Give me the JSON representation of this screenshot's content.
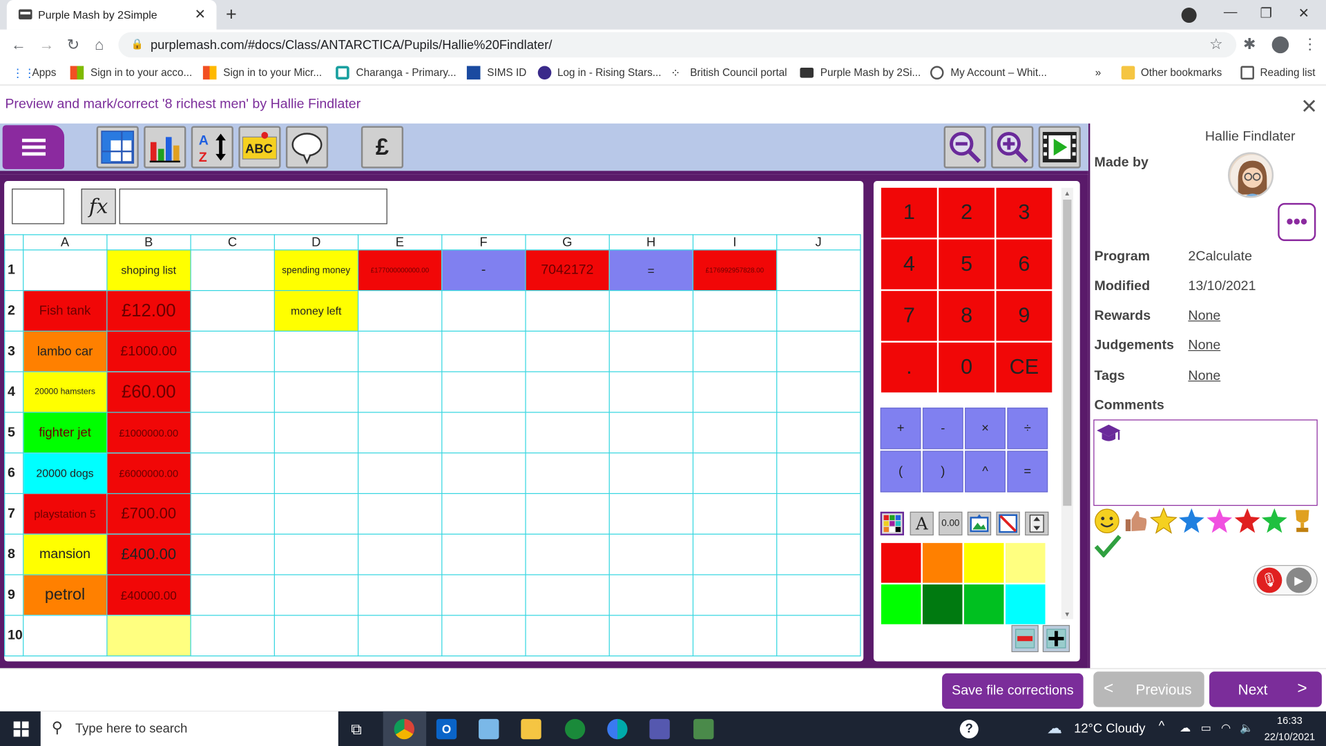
{
  "browser": {
    "tab_title": "Purple Mash by 2Simple",
    "url": "purplemash.com/#docs/Class/ANTARCTICA/Pupils/Hallie%20Findlater/",
    "bookmarks": [
      "Apps",
      "Sign in to your acco...",
      "Sign in to your Micr...",
      "Charanga - Primary...",
      "SIMS ID",
      "Log in - Rising Stars...",
      "British Council portal",
      "Purple Mash by 2Si...",
      "My Account – Whit..."
    ],
    "more_bookmarks": "»",
    "other_bookmarks": "Other bookmarks",
    "reading_list": "Reading list"
  },
  "header": {
    "title": "Preview and mark/correct '8 richest men' by Hallie Findlater"
  },
  "toolbar": {
    "currency_label": "£"
  },
  "sheet": {
    "columns": [
      "A",
      "B",
      "C",
      "D",
      "E",
      "F",
      "G",
      "H",
      "I",
      "J"
    ],
    "rows": [
      {
        "n": "1",
        "cells": [
          "",
          "shoping list",
          "",
          "spending money",
          "£177000000000.00",
          "-",
          "7042172",
          "=",
          "£176992957828.00",
          ""
        ]
      },
      {
        "n": "2",
        "cells": [
          "Fish tank",
          "£12.00",
          "",
          "money left",
          "",
          "",
          "",
          "",
          "",
          ""
        ]
      },
      {
        "n": "3",
        "cells": [
          "lambo car",
          "£1000.00",
          "",
          "",
          "",
          "",
          "",
          "",
          "",
          ""
        ]
      },
      {
        "n": "4",
        "cells": [
          "20000 hamsters",
          "£60.00",
          "",
          "",
          "",
          "",
          "",
          "",
          "",
          ""
        ]
      },
      {
        "n": "5",
        "cells": [
          "fighter jet",
          "£1000000.00",
          "",
          "",
          "",
          "",
          "",
          "",
          "",
          ""
        ]
      },
      {
        "n": "6",
        "cells": [
          "20000 dogs",
          "£6000000.00",
          "",
          "",
          "",
          "",
          "",
          "",
          "",
          ""
        ]
      },
      {
        "n": "7",
        "cells": [
          "playstation 5",
          "£700.00",
          "",
          "",
          "",
          "",
          "",
          "",
          "",
          ""
        ]
      },
      {
        "n": "8",
        "cells": [
          "mansion",
          "£400.00",
          "",
          "",
          "",
          "",
          "",
          "",
          "",
          ""
        ]
      },
      {
        "n": "9",
        "cells": [
          "petrol",
          "£40000.00",
          "",
          "",
          "",
          "",
          "",
          "",
          "",
          ""
        ]
      },
      {
        "n": "10",
        "cells": [
          "",
          "",
          "",
          "",
          "",
          "",
          "",
          "",
          "",
          ""
        ]
      }
    ]
  },
  "calculator": {
    "keys": [
      [
        "1",
        "2",
        "3"
      ],
      [
        "4",
        "5",
        "6"
      ],
      [
        "7",
        "8",
        "9"
      ],
      [
        ".",
        "0",
        "CE"
      ]
    ],
    "ops": [
      [
        "+",
        "-",
        "×",
        "÷"
      ],
      [
        "(",
        ")",
        "^",
        "="
      ]
    ],
    "number_format_label": "0.00"
  },
  "info": {
    "student_name": "Hallie Findlater",
    "made_by_label": "Made by",
    "program_label": "Program",
    "program": "2Calculate",
    "modified_label": "Modified",
    "modified": "13/10/2021",
    "rewards_label": "Rewards",
    "rewards": "None",
    "judgements_label": "Judgements",
    "judgements": "None",
    "tags_label": "Tags",
    "tags": "None",
    "comments_label": "Comments"
  },
  "footer": {
    "save": "Save file corrections",
    "previous": "Previous",
    "next": "Next"
  },
  "taskbar": {
    "search_placeholder": "Type here to search",
    "weather": "12°C  Cloudy",
    "time": "16:33",
    "date": "22/10/2021"
  },
  "colors": {
    "purple": "#7b2d9a",
    "cell_red": "#f10707",
    "cell_orange": "#ff8000",
    "cell_yellow": "#ffff00",
    "cell_lightyellow": "#ffff80",
    "cell_green": "#00ff00",
    "cell_cyan": "#00ffff",
    "cell_blue": "#8080f0"
  }
}
